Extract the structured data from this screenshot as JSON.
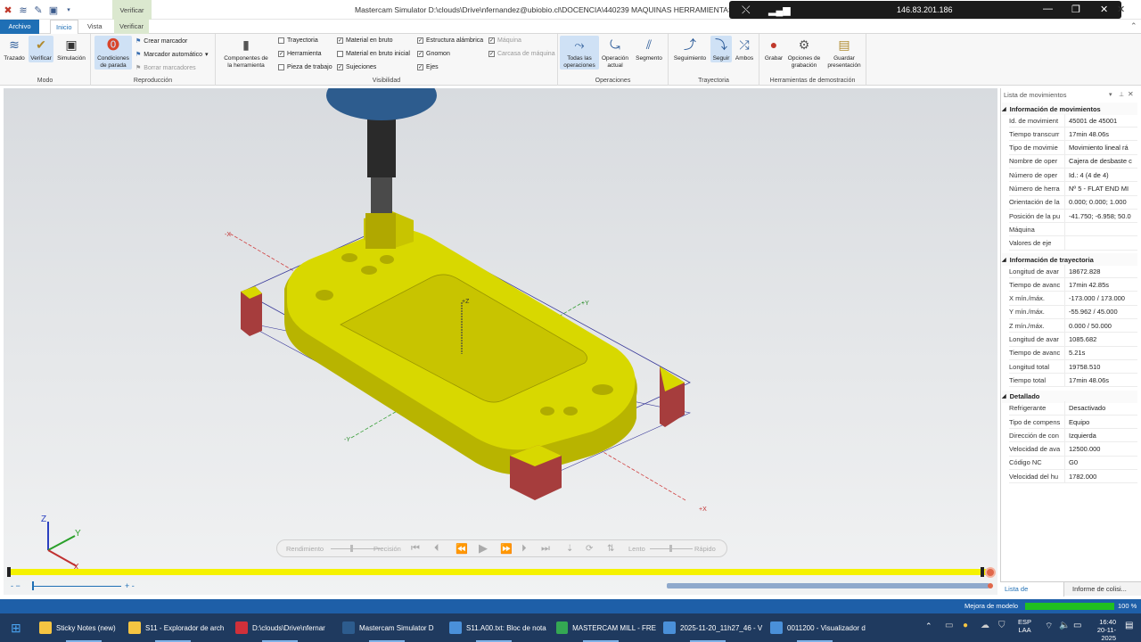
{
  "titlebar": {
    "context_tab": "Verificar",
    "window_title": "Mastercam Simulator  D:\\clouds\\Drive\\nfernandez@ubiobio.cl\\DOCENCIA\\440239 MAQUINAS HERRAMIENTAS\\2025-2",
    "remote_ip": "146.83.201.186"
  },
  "ribbon_tabs": {
    "archivo": "Archivo",
    "inicio": "Inicio",
    "vista": "Vista",
    "verificar": "Verificar"
  },
  "ribbon": {
    "modo": {
      "label": "Modo",
      "trazado": "Trazado",
      "verificar": "Verificar",
      "simulacion": "Simulación"
    },
    "reproduccion": {
      "label": "Reproducción",
      "condiciones": "Condiciones",
      "condiciones2": "de parada",
      "crear_marcador": "Crear marcador",
      "marcador_auto": "Marcador automático",
      "borrar_marcadores": "Borrar marcadores"
    },
    "visibilidad": {
      "label": "Visibilidad",
      "componentes": "Componentes de",
      "componentes2": "la herramienta",
      "items": [
        {
          "label": "Trayectoria",
          "checked": false
        },
        {
          "label": "Herramienta",
          "checked": true
        },
        {
          "label": "Pieza de trabajo",
          "checked": false
        },
        {
          "label": "Material en bruto",
          "checked": true
        },
        {
          "label": "Material en bruto inicial",
          "checked": false
        },
        {
          "label": "Sujeciones",
          "checked": true
        },
        {
          "label": "Estructura alámbrica",
          "checked": true
        },
        {
          "label": "Gnomon",
          "checked": true
        },
        {
          "label": "Ejes",
          "checked": true
        },
        {
          "label": "Máquina",
          "checked": true
        },
        {
          "label": "Carcasa de máquina",
          "checked": true
        }
      ]
    },
    "operaciones": {
      "label": "Operaciones",
      "todas": "Todas las",
      "todas2": "operaciones",
      "actual": "Operación",
      "actual2": "actual",
      "segmento": "Segmento"
    },
    "trayectoria": {
      "label": "Trayectoria",
      "seguimiento": "Seguimiento",
      "seguir": "Seguir",
      "ambos": "Ambos"
    },
    "demo": {
      "label": "Herramientas de demostración",
      "grabar": "Grabar",
      "opciones": "Opciones de",
      "opciones2": "grabación",
      "guardar": "Guardar",
      "guardar2": "presentación"
    }
  },
  "viewport": {
    "axis_labels": {
      "x_neg": "-X",
      "x_pos": "+X",
      "y_pos": "+Y",
      "y_neg": "-Y",
      "z_pos": "+Z"
    },
    "gnomon": {
      "x": "X",
      "y": "Y",
      "z": "Z"
    },
    "playback": {
      "rendimiento": "Rendimiento",
      "precision": "Precisión",
      "lento": "Lento",
      "rapido": "Rápido"
    },
    "progress": 0.99
  },
  "panel": {
    "title": "Lista de movimientos",
    "sections": [
      {
        "title": "Información de movimientos",
        "rows": [
          [
            "Id. de movimient",
            "45001 de 45001"
          ],
          [
            "Tiempo transcurr",
            "17min 48.06s"
          ],
          [
            "Tipo de movimie",
            "Movimiento lineal rá"
          ],
          [
            "Nombre de oper",
            "Cajera de desbaste c"
          ],
          [
            "Número de oper",
            "Id.: 4 (4 de 4)"
          ],
          [
            "Número de herra",
            "Nº 5 - FLAT END MI"
          ],
          [
            "Orientación de la",
            "0.000; 0.000; 1.000"
          ],
          [
            "Posición de la pu",
            "-41.750; -6.958; 50.0"
          ],
          [
            "Máquina",
            ""
          ],
          [
            "Valores de eje",
            ""
          ]
        ]
      },
      {
        "title": "Información de trayectoria",
        "rows": [
          [
            "Longitud de avar",
            "18672.828"
          ],
          [
            "Tiempo de avanc",
            "17min 42.85s"
          ],
          [
            "X mín./máx.",
            "-173.000 / 173.000"
          ],
          [
            "Y mín./máx.",
            "-55.962 / 45.000"
          ],
          [
            "Z mín./máx.",
            "0.000 / 50.000"
          ],
          [
            "Longitud de avar",
            "1085.682"
          ],
          [
            "Tiempo de avanc",
            "5.21s"
          ],
          [
            "Longitud total",
            "19758.510"
          ],
          [
            "Tiempo total",
            "17min 48.06s"
          ]
        ]
      },
      {
        "title": "Detallado",
        "rows": [
          [
            "Refrigerante",
            "Desactivado"
          ],
          [
            "Tipo de compens",
            "Equipo"
          ],
          [
            "Dirección de con",
            "Izquierda"
          ],
          [
            "Velocidad de ava",
            "12500.000"
          ],
          [
            "Código NC",
            "G0"
          ],
          [
            "Velocidad del hu",
            "1782.000"
          ]
        ]
      }
    ],
    "tab1": "Lista de movimie...",
    "tab2": "Informe de colisi..."
  },
  "status": {
    "label": "Mejora de modelo",
    "percent": "100 %",
    "progress": 1.0
  },
  "taskbar": {
    "items": [
      "Sticky Notes (new)",
      "S11 - Explorador de arch",
      "D:\\clouds\\Drive\\nfernar",
      "Mastercam Simulator  D",
      "S11.A00.txt: Bloc de nota",
      "MASTERCAM MILL - FRE",
      "2025-11-20_11h27_46 - V",
      "0011200 - Visualizador d"
    ],
    "lang": "ESP",
    "lang2": "LAA",
    "time": "16:40",
    "date": "20-11-2025"
  },
  "colors": {
    "accent": "#1f6fb5",
    "part": "#d8d800",
    "fixture": "#a63d3d",
    "progress": "#f5f200"
  }
}
